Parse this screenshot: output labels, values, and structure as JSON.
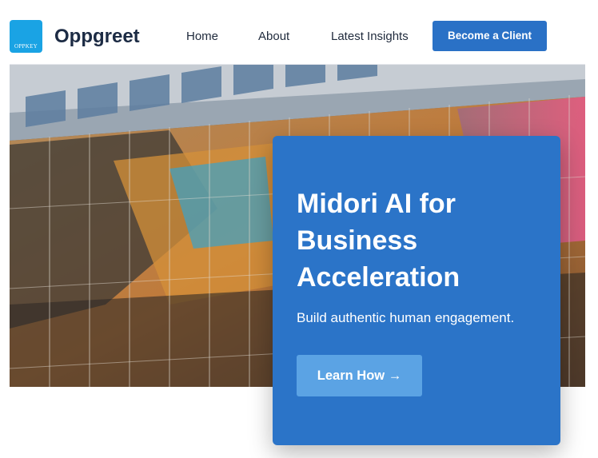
{
  "brand": {
    "badge_text": "OPPKEY",
    "name": "Oppgreet",
    "badge_color": "#1aa3e4"
  },
  "nav": {
    "items": [
      {
        "label": "Home"
      },
      {
        "label": "About"
      },
      {
        "label": "Latest Insights"
      }
    ],
    "cta_label": "Become a Client"
  },
  "hero": {
    "image": "glass-building-facade",
    "title": "Midori AI for Business Acceleration",
    "subtitle": "Build authentic human engagement.",
    "button_label": "Learn How →"
  },
  "colors": {
    "primary": "#2a71c6",
    "card": "#2b74c8",
    "button_light": "#5ba3e4",
    "text_dark": "#1c2b44"
  }
}
